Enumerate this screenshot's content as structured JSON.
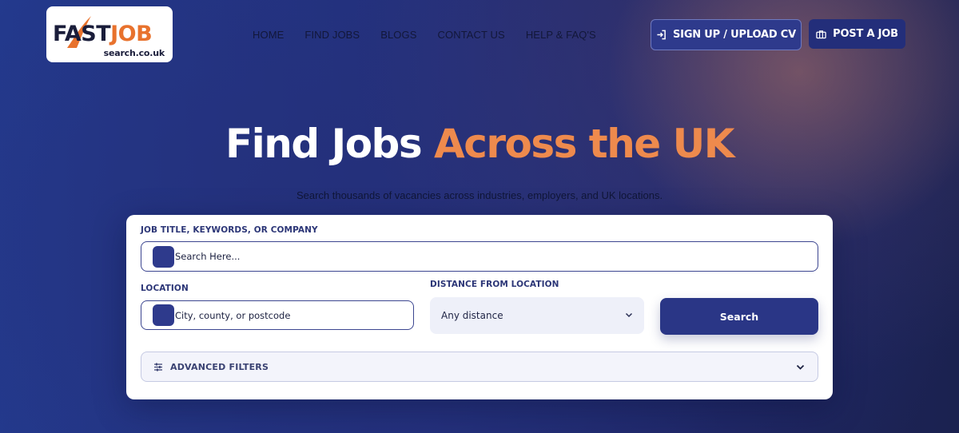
{
  "logo": {
    "word1": "FAST",
    "word2": "JOB",
    "sub": "search.co.uk"
  },
  "nav": {
    "items": [
      "HOME",
      "FIND JOBS",
      "BLOGS",
      "CONTACT US",
      "HELP & FAQ'S"
    ]
  },
  "header": {
    "signup_label": "SIGN UP / UPLOAD CV",
    "post_label": "POST A JOB"
  },
  "hero": {
    "title_part1": "Find Jobs ",
    "title_part2": "Across the UK",
    "subtitle": "Search thousands of vacancies across industries, employers, and UK locations."
  },
  "search": {
    "keyword_label": "JOB TITLE, KEYWORDS, OR COMPANY",
    "keyword_placeholder": "Search Here...",
    "location_label": "LOCATION",
    "location_placeholder": "City, county, or postcode",
    "distance_label": "DISTANCE FROM LOCATION",
    "distance_value": "Any distance",
    "button_label": "Search",
    "advanced_label": "ADVANCED FILTERS"
  },
  "colors": {
    "brand_dark": "#1a1d3a",
    "brand_orange": "#e8722d",
    "accent_orange": "#ee8a4d",
    "primary_blue": "#2a3686"
  }
}
